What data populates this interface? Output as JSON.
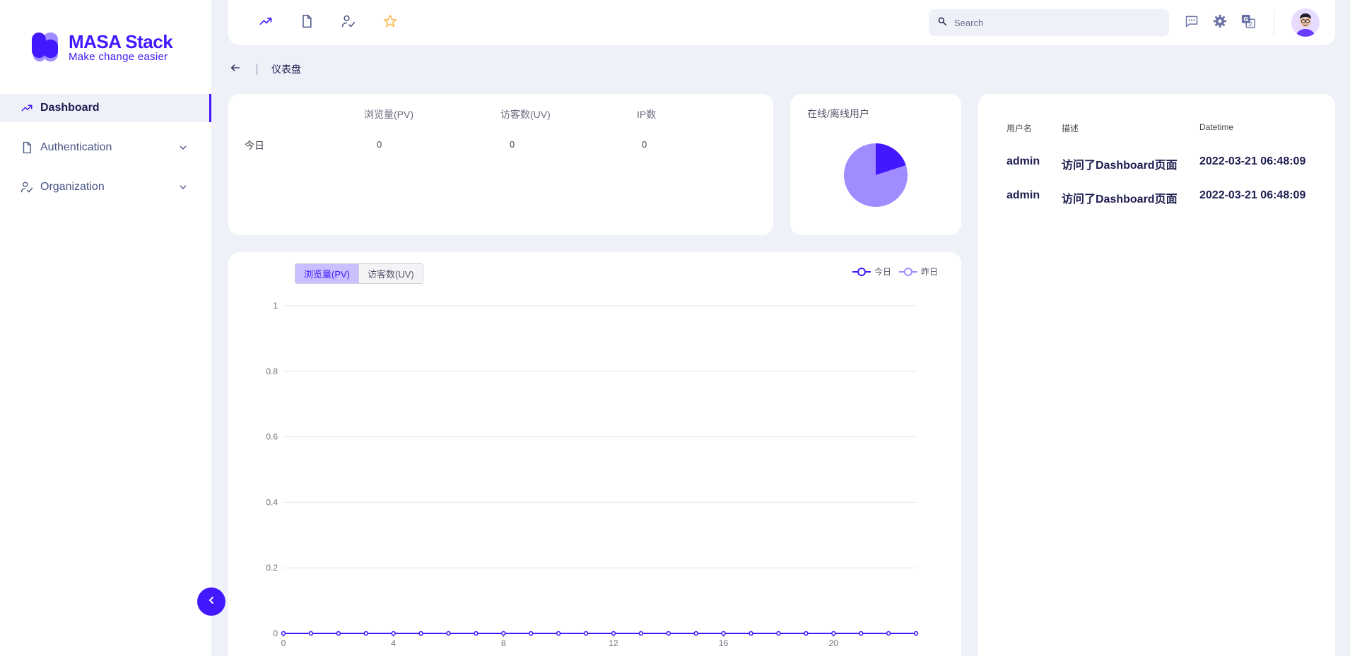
{
  "brand": {
    "title": "MASA Stack",
    "subtitle": "Make change easier"
  },
  "sidebar": {
    "items": [
      {
        "label": "Dashboard",
        "icon": "trending-up-icon",
        "active": true
      },
      {
        "label": "Authentication",
        "icon": "file-icon",
        "expandable": true
      },
      {
        "label": "Organization",
        "icon": "user-check-icon",
        "expandable": true
      }
    ],
    "collapse_icon": "chevron-left-icon"
  },
  "topbar": {
    "shortcuts": [
      "trending-up-icon",
      "file-icon",
      "user-check-icon",
      "star-icon"
    ],
    "search": {
      "placeholder": "Search",
      "value": ""
    },
    "actions": [
      "message-icon",
      "gear-icon",
      "translate-icon"
    ]
  },
  "breadcrumb": {
    "back_icon": "arrow-left-icon",
    "current": "仪表盘"
  },
  "stats": {
    "columns": [
      "浏览量(PV)",
      "访客数(UV)",
      "IP数"
    ],
    "rows": [
      {
        "label": "今日",
        "values": [
          "0",
          "0",
          "0"
        ]
      }
    ]
  },
  "online_users": {
    "title": "在线/离线用户",
    "slices": [
      {
        "value": 20,
        "color": "#4318ff"
      },
      {
        "value": 80,
        "color": "#a08cff"
      }
    ]
  },
  "logs": {
    "columns": [
      "用户名",
      "描述",
      "Datetime"
    ],
    "rows": [
      [
        "admin",
        "访问了Dashboard页面",
        "2022-03-21 06:48:09"
      ],
      [
        "admin",
        "访问了Dashboard页面",
        "2022-03-21 06:48:09"
      ]
    ]
  },
  "chart_tabs": {
    "items": [
      "浏览量(PV)",
      "访客数(UV)"
    ],
    "selected": 0
  },
  "chart_data": {
    "type": "line",
    "x": [
      0,
      1,
      2,
      3,
      4,
      5,
      6,
      7,
      8,
      9,
      10,
      11,
      12,
      13,
      14,
      15,
      16,
      17,
      18,
      19,
      20,
      21,
      22,
      23
    ],
    "series": [
      {
        "name": "今日",
        "color": "#4318ff",
        "values": [
          0,
          0,
          0,
          0,
          0,
          0,
          0,
          0,
          0,
          0,
          0,
          0,
          0,
          0,
          0,
          0,
          0,
          0,
          0,
          0,
          0,
          0,
          0,
          0
        ]
      },
      {
        "name": "昨日",
        "color": "#a08cff",
        "values": [
          0,
          0,
          0,
          0,
          0,
          0,
          0,
          0,
          0,
          0,
          0,
          0,
          0,
          0,
          0,
          0,
          0,
          0,
          0,
          0,
          0,
          0,
          0,
          0
        ]
      }
    ],
    "xticks": [
      0,
      4,
      8,
      12,
      16,
      20
    ],
    "yticks": [
      0,
      0.2,
      0.4,
      0.6,
      0.8,
      1
    ],
    "xlim": [
      0,
      23
    ],
    "ylim": [
      0,
      1
    ],
    "grid": true,
    "legend": "top-right"
  }
}
